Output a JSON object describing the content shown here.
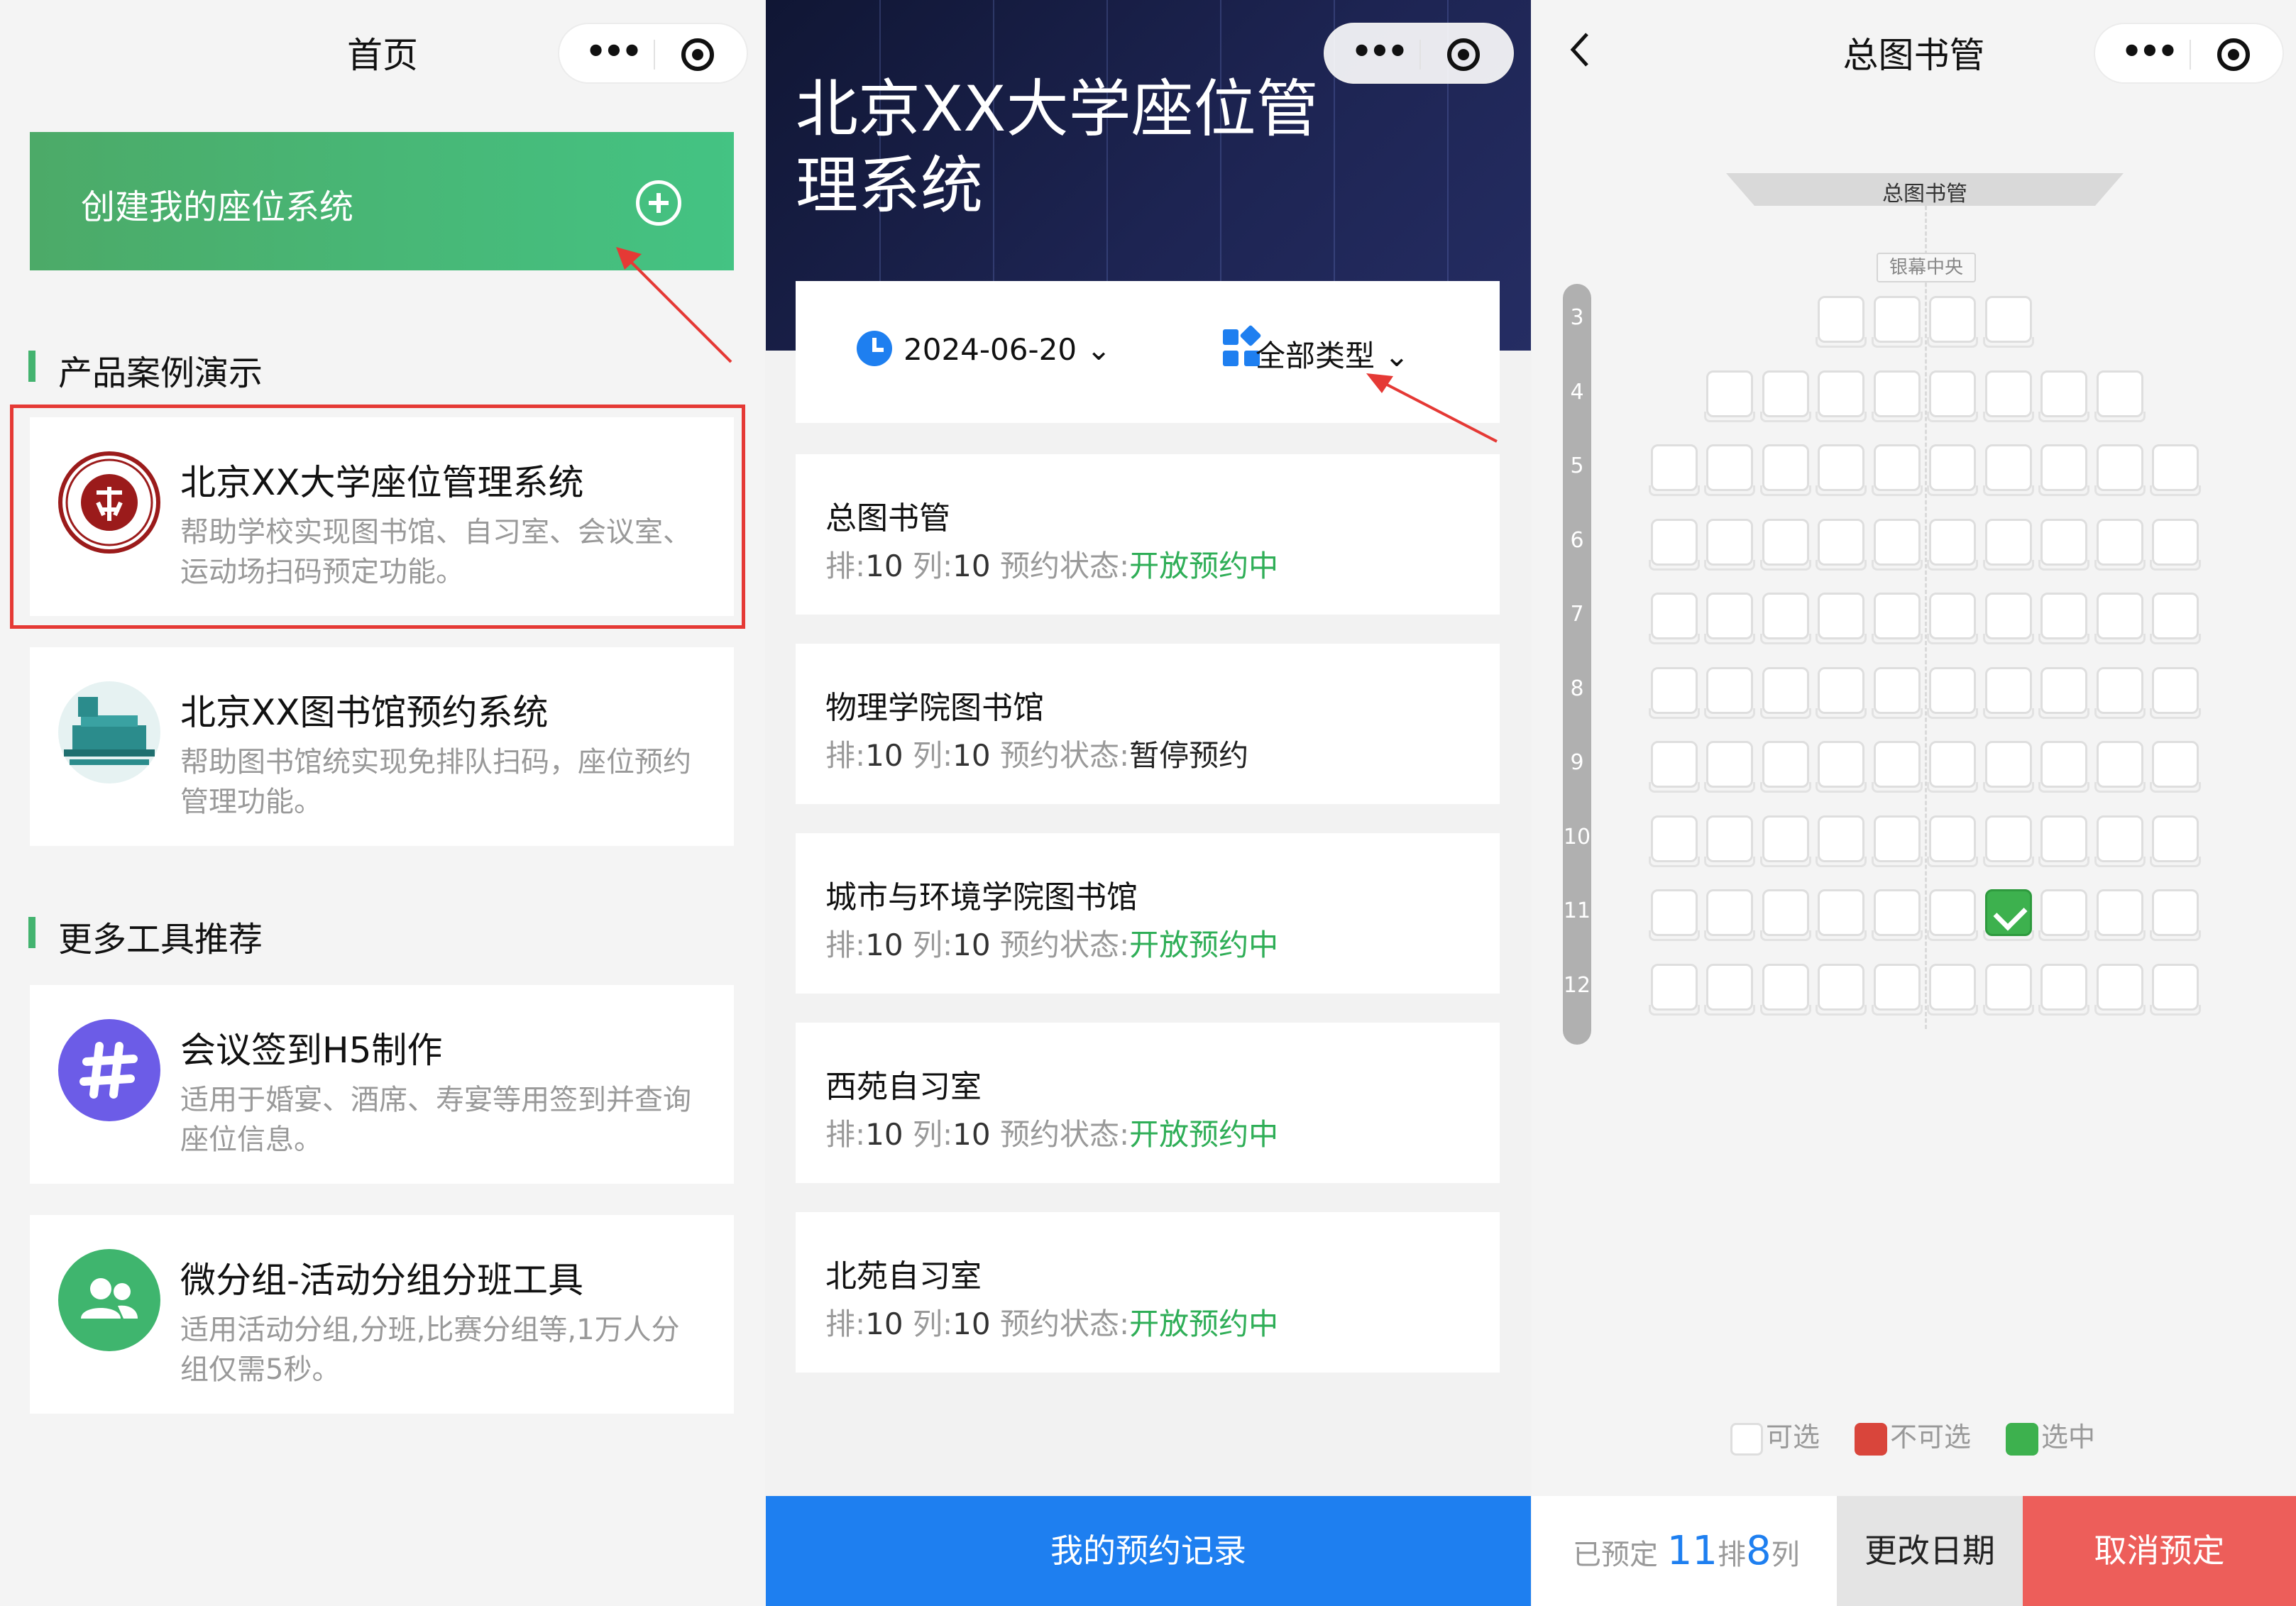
{
  "home": {
    "nav_title": "首页",
    "create_label": "创建我的座位系统",
    "section_demo": "产品案例演示",
    "section_more": "更多工具推荐",
    "cards": [
      {
        "title": "北京XX大学座位管理系统",
        "desc": "帮助学校实现图书馆、自习室、会议室、运动场扫码预定功能。",
        "icon": "university-seal-icon"
      },
      {
        "title": "北京XX图书馆预约系统",
        "desc": "帮助图书馆统实现免排队扫码，座位预约管理功能。",
        "icon": "library-building-icon"
      },
      {
        "title": "会议签到H5制作",
        "desc": "适用于婚宴、酒席、寿宴等用签到并查询座位信息。",
        "icon": "hashtag-icon",
        "color": "#6c5ce7"
      },
      {
        "title": "微分组-活动分组分班工具",
        "desc": "适用活动分组,分班,比赛分组等,1万人分组仅需5秒。",
        "icon": "people-group-icon",
        "color": "#3fb56e"
      }
    ]
  },
  "system": {
    "title": "北京XX大学座位管理系统",
    "date": "2024-06-20",
    "category": "全部类型",
    "row_label": "排:",
    "col_label": "列:",
    "status_label": "预约状态:",
    "libraries": [
      {
        "name": "总图书管",
        "rows": "10",
        "cols": "10",
        "status": "开放预约中",
        "open": true
      },
      {
        "name": "物理学院图书馆",
        "rows": "10",
        "cols": "10",
        "status": "暂停预约",
        "open": false
      },
      {
        "name": "城市与环境学院图书馆",
        "rows": "10",
        "cols": "10",
        "status": "开放预约中",
        "open": true
      },
      {
        "name": "西苑自习室",
        "rows": "10",
        "cols": "10",
        "status": "开放预约中",
        "open": true
      },
      {
        "name": "北苑自习室",
        "rows": "10",
        "cols": "10",
        "status": "开放预约中",
        "open": true
      }
    ],
    "my_records_button": "我的预约记录"
  },
  "seatmap": {
    "nav_title": "总图书管",
    "screen_label": "总图书管",
    "center_label": "银幕中央",
    "row_numbers": [
      "3",
      "4",
      "5",
      "6",
      "7",
      "8",
      "9",
      "10",
      "11",
      "12"
    ],
    "seat_counts": [
      4,
      8,
      10,
      10,
      10,
      10,
      10,
      10,
      10,
      10
    ],
    "selected_seat": {
      "row": "11",
      "index": 6
    },
    "legend": {
      "available": "可选",
      "unavailable": "不可选",
      "selected": "选中"
    },
    "booked_prefix": "已预定",
    "booked_row": "11",
    "row_unit": "排",
    "booked_col": "8",
    "col_unit": "列",
    "change_date": "更改日期",
    "cancel": "取消预定",
    "colors": {
      "selected": "#3db14e",
      "unavailable": "#d9453b",
      "accent": "#1e7ff0",
      "cancel": "#ed5e5a"
    }
  }
}
